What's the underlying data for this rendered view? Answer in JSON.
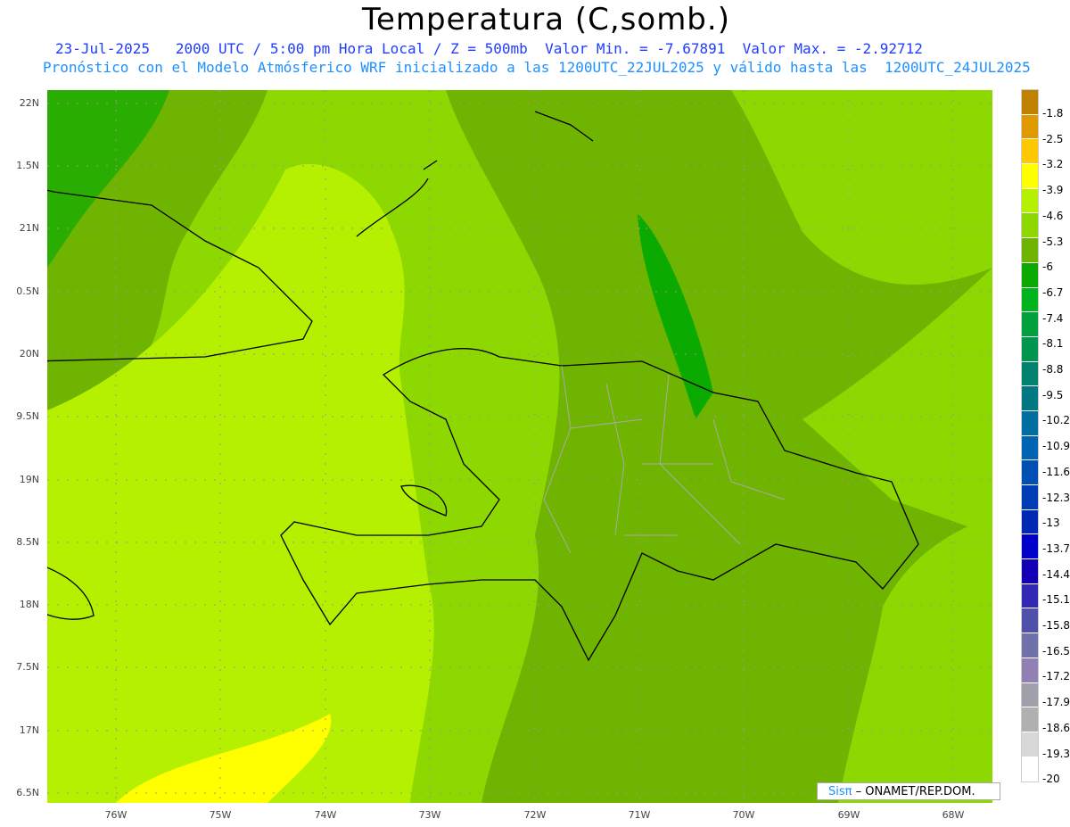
{
  "header": {
    "title": "Temperatura (C,somb.)",
    "line1": "23-Jul-2025   2000 UTC / 5:00 pm Hora Local / Z = 500mb  Valor Min. = -7.67891  Valor Max. = -2.92712",
    "line2": "Pronóstico con el Modelo Atmósferico WRF inicializado a las 1200UTC_22JUL2025 y válido hasta las  1200UTC_24JUL2025"
  },
  "axes": {
    "lat_labels": [
      "22N",
      "1.5N",
      "21N",
      "0.5N",
      "20N",
      "9.5N",
      "19N",
      "8.5N",
      "18N",
      "7.5N",
      "17N",
      "6.5N"
    ],
    "lon_labels": [
      "76W",
      "75W",
      "74W",
      "73W",
      "72W",
      "71W",
      "70W",
      "69W",
      "68W"
    ]
  },
  "legend": {
    "colors": [
      "#c08000",
      "#e09a00",
      "#ffc800",
      "#ffff00",
      "#b4f000",
      "#8cd800",
      "#6eb400",
      "#0aaa00",
      "#00b41e",
      "#00a03c",
      "#009650",
      "#00826e",
      "#007882",
      "#006ea0",
      "#0064b4",
      "#0050b4",
      "#003cb4",
      "#0028b4",
      "#0000c8",
      "#1400b4",
      "#3228b4",
      "#5050aa",
      "#7070aa",
      "#9080b4",
      "#a0a0aa",
      "#b0b0b0",
      "#d8d8d8",
      "#ffffff"
    ],
    "labels": [
      "-1.8",
      "-2.5",
      "-3.2",
      "-3.9",
      "-4.6",
      "-5.3",
      "-6",
      "-6.7",
      "-7.4",
      "-8.1",
      "-8.8",
      "-9.5",
      "-10.2",
      "-10.9",
      "-11.6",
      "-12.3",
      "-13",
      "-13.7",
      "-14.4",
      "-15.1",
      "-15.8",
      "-16.5",
      "-17.2",
      "-17.9",
      "-18.6",
      "-19.3",
      "-20"
    ]
  },
  "credit": {
    "brand": "Sisπ",
    "text": " – ONAMET/REP.DOM."
  }
}
